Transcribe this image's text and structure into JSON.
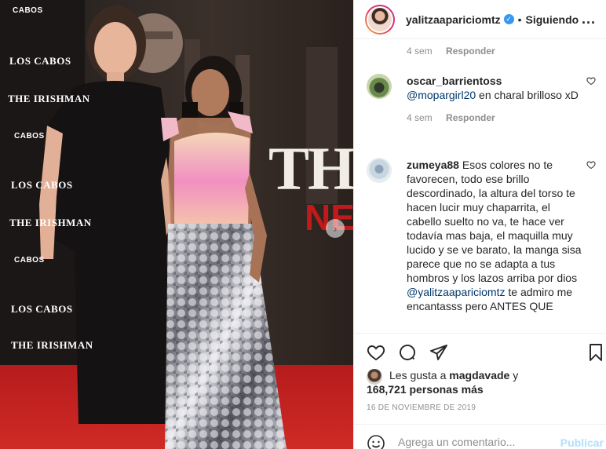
{
  "post": {
    "backdrop_logos": [
      "CABOS",
      "LOS CABOS",
      "THE IRISHMAN",
      "CABOS",
      "LOS CABOS",
      "THE IRISHMAN",
      "CABOS",
      "LOS CABOS",
      "THE IRISHMAN"
    ],
    "backdrop_big_text": "THE IRISH",
    "backdrop_brand_text": "NET"
  },
  "header": {
    "username": "yalitzaapariciomtz",
    "dot": "•",
    "follow_label": "Siguiendo",
    "more_label": "..."
  },
  "comments": {
    "top_meta": {
      "time": "4 sem",
      "reply": "Responder"
    },
    "items": [
      {
        "author": "oscar_barrientoss",
        "mention": "@mopargirl20",
        "text": " en charal brilloso xD",
        "time": "4 sem",
        "reply": "Responder"
      },
      {
        "author": "zumeya88",
        "text": " Esos colores no te favorecen, todo ese brillo descordinado, la altura del torso te hacen lucir muy chaparrita, el cabello suelto no va, te hace ver todavía mas baja, el maquilla muy lucido y se ve barato, la manga sisa parece que no se adapta a tus hombros y los lazos arriba por dios ",
        "mention": "@yalitzaapariciomtz",
        "text_after": " te admiro me encantasss pero ANTES QUE"
      }
    ]
  },
  "likes": {
    "prefix": "Les gusta a ",
    "liker": "magdavade",
    "conj": " y",
    "count_text": "168,721 personas más"
  },
  "date": "16 DE NOVIEMBRE DE 2019",
  "composer": {
    "placeholder": "Agrega un comentario...",
    "publish_label": "Publicar"
  },
  "colors": {
    "accent_blue": "#3897f0",
    "publish_disabled": "#b2dffc",
    "mention": "#00376b"
  }
}
